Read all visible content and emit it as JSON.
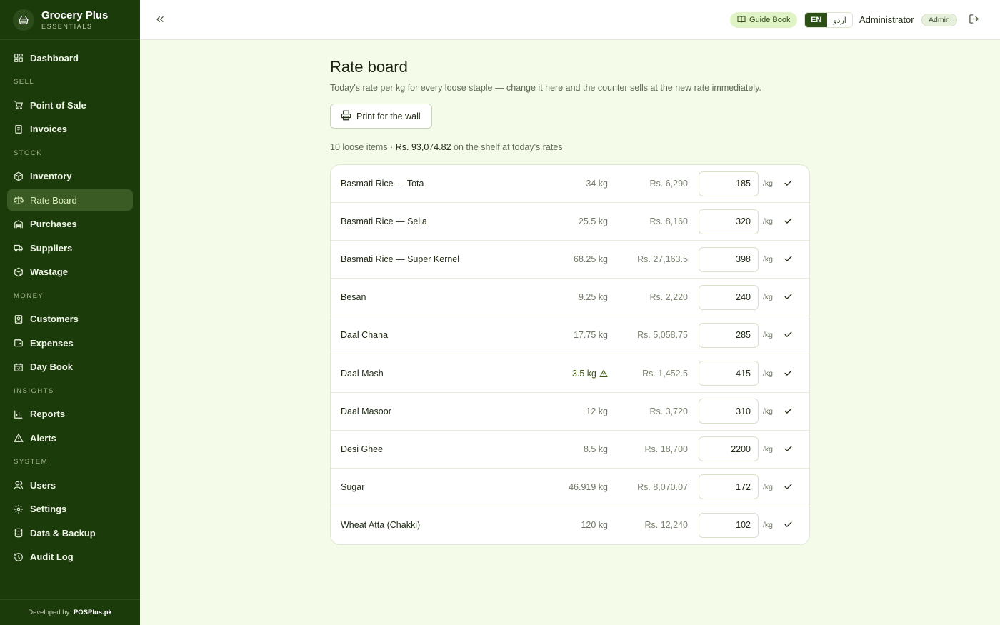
{
  "app": {
    "name": "Grocery Plus",
    "subtitle": "ESSENTIALS",
    "footer_prefix": "Developed by:",
    "footer_brand": "POSPlus.pk"
  },
  "sidebar": {
    "dashboard": "Dashboard",
    "sections": {
      "sell": "SELL",
      "stock": "STOCK",
      "money": "MONEY",
      "insights": "INSIGHTS",
      "system": "SYSTEM"
    },
    "items": {
      "point_of_sale": "Point of Sale",
      "invoices": "Invoices",
      "inventory": "Inventory",
      "rate_board": "Rate Board",
      "purchases": "Purchases",
      "suppliers": "Suppliers",
      "wastage": "Wastage",
      "customers": "Customers",
      "expenses": "Expenses",
      "day_book": "Day Book",
      "reports": "Reports",
      "alerts": "Alerts",
      "users": "Users",
      "settings": "Settings",
      "data_backup": "Data & Backup",
      "audit_log": "Audit Log"
    },
    "active": "rate_board"
  },
  "header": {
    "guide_book": "Guide Book",
    "lang_en": "EN",
    "lang_ur": "اردو",
    "user_name": "Administrator",
    "role": "Admin"
  },
  "page": {
    "title": "Rate board",
    "description": "Today's rate per kg for every loose staple — change it here and the counter sells at the new rate immediately.",
    "print_button": "Print for the wall",
    "summary_count": "10 loose items ·",
    "summary_value": "Rs. 93,074.82",
    "summary_suffix": "on the shelf at today's rates",
    "unit_label": "/kg"
  },
  "items": [
    {
      "name": "Basmati Rice — Tota",
      "qty": "34 kg",
      "value": "Rs. 6,290",
      "rate": "185",
      "low": false
    },
    {
      "name": "Basmati Rice — Sella",
      "qty": "25.5 kg",
      "value": "Rs. 8,160",
      "rate": "320",
      "low": false
    },
    {
      "name": "Basmati Rice — Super Kernel",
      "qty": "68.25 kg",
      "value": "Rs. 27,163.5",
      "rate": "398",
      "low": false
    },
    {
      "name": "Besan",
      "qty": "9.25 kg",
      "value": "Rs. 2,220",
      "rate": "240",
      "low": false
    },
    {
      "name": "Daal Chana",
      "qty": "17.75 kg",
      "value": "Rs. 5,058.75",
      "rate": "285",
      "low": false
    },
    {
      "name": "Daal Mash",
      "qty": "3.5 kg",
      "value": "Rs. 1,452.5",
      "rate": "415",
      "low": true
    },
    {
      "name": "Daal Masoor",
      "qty": "12 kg",
      "value": "Rs. 3,720",
      "rate": "310",
      "low": false
    },
    {
      "name": "Desi Ghee",
      "qty": "8.5 kg",
      "value": "Rs. 18,700",
      "rate": "2200",
      "low": false
    },
    {
      "name": "Sugar",
      "qty": "46.919 kg",
      "value": "Rs. 8,070.07",
      "rate": "172",
      "low": false
    },
    {
      "name": "Wheat Atta (Chakki)",
      "qty": "120 kg",
      "value": "Rs. 12,240",
      "rate": "102",
      "low": false
    }
  ],
  "colors": {
    "sidebar_bg": "#1c3b0b",
    "active_item": "#3a5b24",
    "page_bg": "#f4fbe9",
    "accent": "#2c5015",
    "guide_badge": "#dff3c4"
  }
}
